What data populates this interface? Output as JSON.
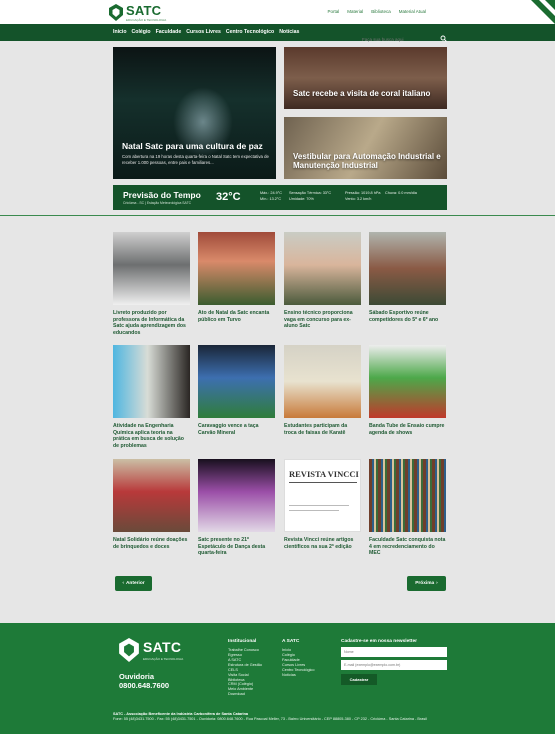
{
  "header": {
    "logo_name": "SATC",
    "logo_sub": "EDUCAÇÃO E TECNOLOGIA",
    "top_links": [
      "Portal",
      "Material",
      "Biblioteca",
      "Material Atual"
    ]
  },
  "nav": {
    "items": [
      "Início",
      "Colégio",
      "Faculdade",
      "Cursos Livres",
      "Centro Tecnológico",
      "Notícias"
    ],
    "search_placeholder": "Faça sua busca aqui"
  },
  "hero": {
    "main_title": "Natal Satc para uma cultura de paz",
    "main_summary": "Com abertura na 19 horas desta quarta-feira o Natal Satc tem expectativa de receber 1.000 pessoas, entre pais e familiares...",
    "right_top_title": "Satc recebe a visita de coral italiano",
    "right_bottom_title": "Vestibular para Automação Industrial e Manutenção Industrial"
  },
  "weather": {
    "title": "Previsão do Tempo",
    "location": "Criciúma - SC | Estação Meteorológica SATC",
    "temp": "32°C",
    "max": "Máx.: 24.9°C",
    "min": "Mín.: 13.2°C",
    "sensation": "Sensação Térmica: 33°C",
    "humidity": "Umidade: 70%",
    "pressure": "Pressão: 1019.8 hPa",
    "wind": "Vento: 3.2 km/h",
    "rain": "Chuva: 0.0 mm/dia"
  },
  "news": [
    {
      "title": "Livreto produzido por professora de Informática da Satc ajuda aprendizagem dos educandos"
    },
    {
      "title": "Ato de Natal da Satc encanta público em Turvo"
    },
    {
      "title": "Ensino técnico proporciona vaga em concurso para ex-aluno Satc"
    },
    {
      "title": "Sábado Esportivo reúne competidores do 5º e 6º ano"
    },
    {
      "title": "Atividade na Engenharia Química aplica teoria na prática em busca de solução de problemas"
    },
    {
      "title": "Caravaggio vence a taça Carvão Mineral"
    },
    {
      "title": "Estudantes participam da troca de faixas de Karatê"
    },
    {
      "title": "Banda Tube de Ensaio cumpre agenda de shows"
    },
    {
      "title": "Natal Solidário reúne doações de brinquedos e doces"
    },
    {
      "title": "Satc presente no 21º Espetáculo de Dança desta quarta-feira"
    },
    {
      "title": "Revista Vincci reúne artigos científicos na sua 2ª edição"
    },
    {
      "title": "Faculdade Satc conquista nota 4 em recredenciamento do MEC"
    }
  ],
  "pagination": {
    "prev": "Anterior",
    "next": "Próxima"
  },
  "footer": {
    "logo_name": "SATC",
    "logo_sub": "EDUCAÇÃO E TECNOLOGIA",
    "ouvidoria": "Ouvidoria",
    "phone": "0800.648.7600",
    "col1_title": "Institucional",
    "col1_items": [
      "Trabalhe Conosco",
      "Egresso",
      "A SATC",
      "Estrutura de Gestão",
      "CELS",
      "Visita Social",
      "Biblioteca",
      "CRM (Colégio)",
      "Meio Ambiente",
      "Download"
    ],
    "col2_title": "A SATC",
    "col2_items": [
      "Início",
      "Colégio",
      "Faculdade",
      "Cursos Livres",
      "Centro Tecnológico",
      "Notícias"
    ],
    "newsletter_title": "Cadastre-se em nossa newsletter",
    "name_placeholder": "Nome",
    "email_placeholder": "E-mail (exemplo@exemplo.com.br)",
    "subscribe": "Cadastrar",
    "org": "SATC - Associação Beneficente da Indústria Carbonífera de Santa Catarina",
    "address": "Fone: 55 (48)3431.7500 - Fax: 55 (48)3431.7501 - Ouvidoria: 0800.648.7600 - Rua Pascoal Meller, 73 - Bairro Universitário - CEP 88805-380 - CP 232 - Criciúma - Santa Catarina - Brasil"
  }
}
